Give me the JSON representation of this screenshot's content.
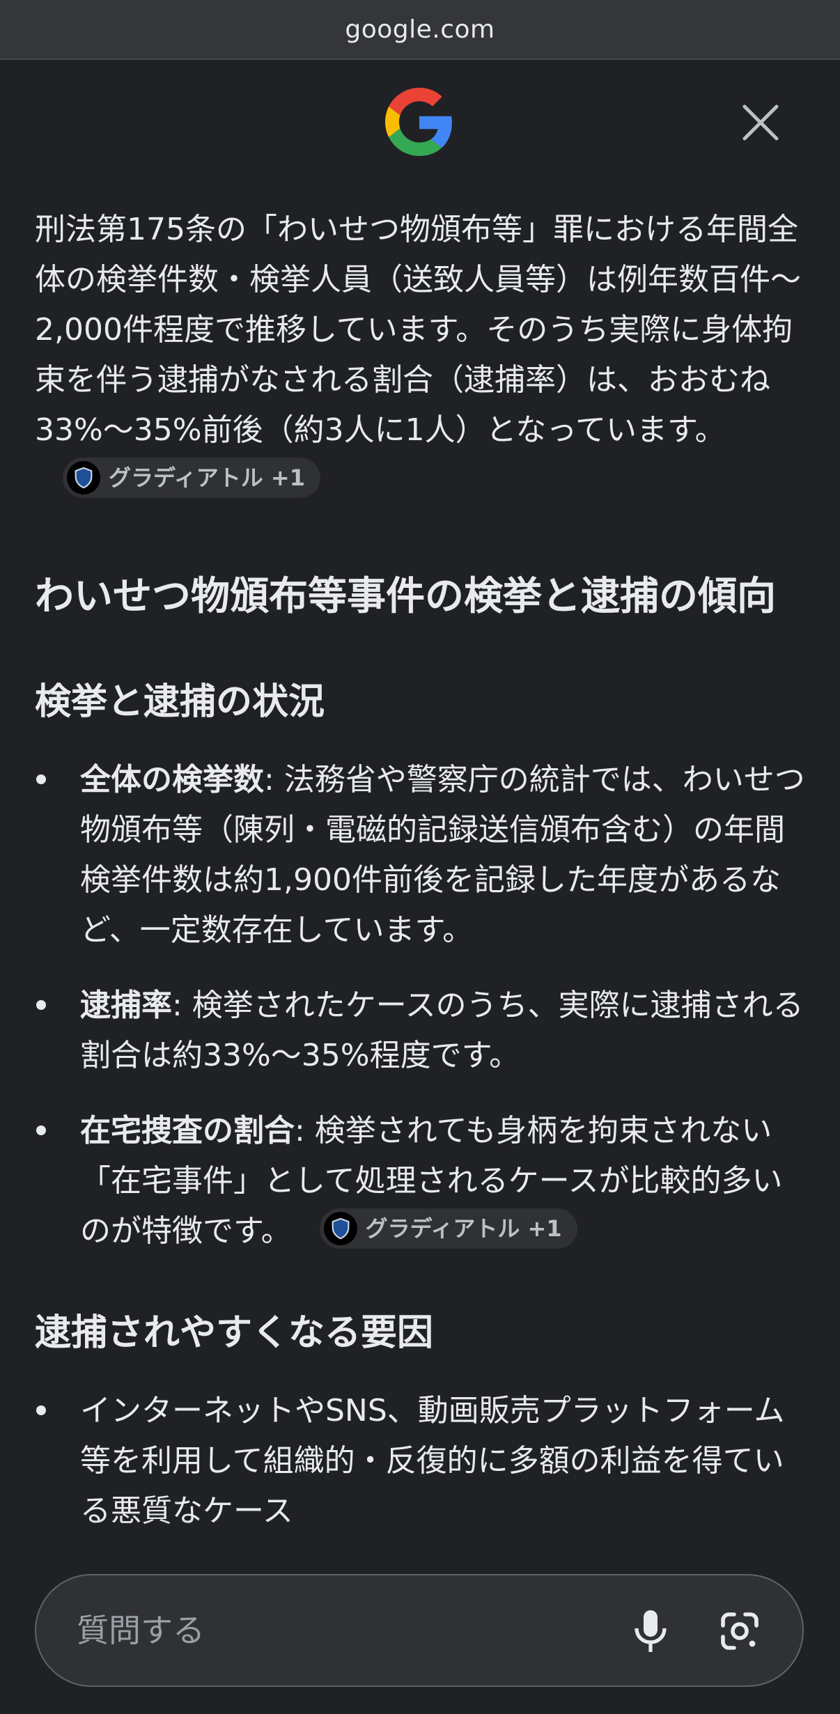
{
  "browser": {
    "url": "google.com"
  },
  "header": {
    "logo": "google-g-logo",
    "close": "close-icon"
  },
  "intro": {
    "text": "刑法第175条の「わいせつ物頒布等」罪における年間全体の検挙件数・検挙人員（送致人員等）は例年数百件〜2,000件程度で推移しています。そのうち実際に身体拘束を伴う逮捕がなされる割合（逮捕率）は、おおむね33%〜35%前後（約3人に1人）となっています。",
    "source_chip": "グラディアトル +1"
  },
  "section1": {
    "title": "わいせつ物頒布等事件の検挙と逮捕の傾向"
  },
  "section2": {
    "title": "検挙と逮捕の状況",
    "items": [
      {
        "label": "全体の検挙数",
        "text": ": 法務省や警察庁の統計では、わいせつ物頒布等（陳列・電磁的記録送信頒布含む）の年間検挙件数は約1,900件前後を記録した年度があるなど、一定数存在しています。"
      },
      {
        "label": "逮捕率",
        "text": ": 検挙されたケースのうち、実際に逮捕される割合は約33%〜35%程度です。"
      },
      {
        "label": "在宅捜査の割合",
        "text": ": 検挙されても身柄を拘束されない「在宅事件」として処理されるケースが比較的多いのが特徴です。",
        "source_chip": "グラディアトル +1"
      }
    ]
  },
  "section3": {
    "title": "逮捕されやすくなる要因",
    "items": [
      {
        "text": "インターネットやSNS、動画販売プラットフォーム等を利用して組織的・反復的に多額の利益を得ている悪質なケース"
      }
    ]
  },
  "ask_bar": {
    "placeholder": "質問する"
  },
  "colors": {
    "background": "#202124",
    "chip": "#303134",
    "text": "#e8eaed"
  }
}
